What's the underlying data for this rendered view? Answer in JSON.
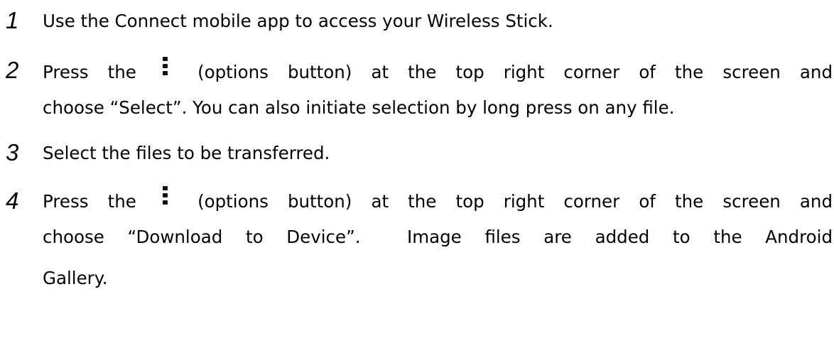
{
  "steps": [
    {
      "number": "1",
      "lines": [
        "Use the Connect mobile app to access your Wireless Stick."
      ]
    },
    {
      "number": "2",
      "prefix": "Press the",
      "icon": "options-kebab-icon",
      "first_line_rest": "(options button) at the top right corner of the screen and",
      "second_line": "choose “Select”. You can also initiate selection by long press on any file."
    },
    {
      "number": "3",
      "lines": [
        "Select the files to be transferred."
      ]
    },
    {
      "number": "4",
      "prefix": "Press the",
      "icon": "options-kebab-icon",
      "first_line_rest": "(options button) at the top right corner of the screen and",
      "second_line": "choose “Download to Device”.  Image files are added to the Android",
      "third_line": "Gallery."
    }
  ]
}
